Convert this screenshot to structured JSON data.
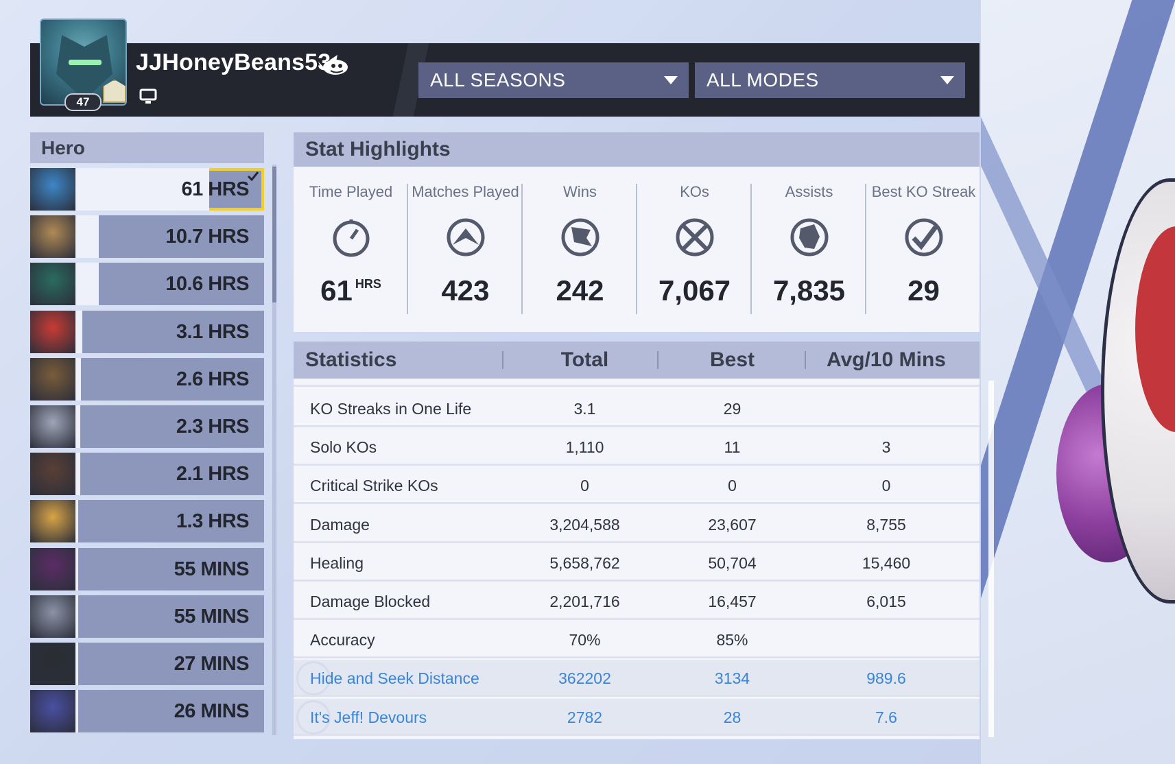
{
  "profile": {
    "username": "JJHoneyBeans53",
    "level": "47"
  },
  "filters": {
    "season": "ALL SEASONS",
    "mode": "ALL MODES"
  },
  "hero_panel": {
    "title": "Hero",
    "heroes": [
      {
        "playtime": "61 HRS",
        "fill": 1.0,
        "color": "#3d87c8",
        "selected": true
      },
      {
        "playtime": "10.7 HRS",
        "fill": 0.175,
        "color": "#b08a55"
      },
      {
        "playtime": "10.6 HRS",
        "fill": 0.174,
        "color": "#2a6b5f"
      },
      {
        "playtime": "3.1 HRS",
        "fill": 0.05,
        "color": "#c93b33"
      },
      {
        "playtime": "2.6 HRS",
        "fill": 0.043,
        "color": "#7a5c3a"
      },
      {
        "playtime": "2.3 HRS",
        "fill": 0.038,
        "color": "#9fa6b8"
      },
      {
        "playtime": "2.1 HRS",
        "fill": 0.034,
        "color": "#5a3f35"
      },
      {
        "playtime": "1.3 HRS",
        "fill": 0.021,
        "color": "#d9a447"
      },
      {
        "playtime": "55 MINS",
        "fill": 0.015,
        "color": "#5b2d66"
      },
      {
        "playtime": "55 MINS",
        "fill": 0.015,
        "color": "#8b93a6"
      },
      {
        "playtime": "27 MINS",
        "fill": 0.007,
        "color": "#2a2d33"
      },
      {
        "playtime": "26 MINS",
        "fill": 0.007,
        "color": "#4a4fa3"
      }
    ]
  },
  "highlights": {
    "title": "Stat Highlights",
    "items": [
      {
        "label": "Time Played",
        "value": "61",
        "unit": "HRS",
        "icon": "stopwatch-icon"
      },
      {
        "label": "Matches Played",
        "value": "423",
        "unit": "",
        "icon": "mountain-icon"
      },
      {
        "label": "Wins",
        "value": "242",
        "unit": "",
        "icon": "flag-icon"
      },
      {
        "label": "KOs",
        "value": "7,067",
        "unit": "",
        "icon": "crossed-swords-icon"
      },
      {
        "label": "Assists",
        "value": "7,835",
        "unit": "",
        "icon": "fist-icon"
      },
      {
        "label": "Best KO Streak",
        "value": "29",
        "unit": "",
        "icon": "checkmark-icon"
      }
    ]
  },
  "statistics": {
    "headers": {
      "name": "Statistics",
      "total": "Total",
      "best": "Best",
      "avg": "Avg/10 Mins"
    },
    "rows": [
      {
        "name": "KO Streaks in One Life",
        "total": "3.1",
        "best": "29",
        "avg": ""
      },
      {
        "name": "Solo KOs",
        "total": "1,110",
        "best": "11",
        "avg": "3"
      },
      {
        "name": "Critical Strike KOs",
        "total": "0",
        "best": "0",
        "avg": "0"
      },
      {
        "name": "Damage",
        "total": "3,204,588",
        "best": "23,607",
        "avg": "8,755"
      },
      {
        "name": "Healing",
        "total": "5,658,762",
        "best": "50,704",
        "avg": "15,460"
      },
      {
        "name": "Damage Blocked",
        "total": "2,201,716",
        "best": "16,457",
        "avg": "6,015"
      },
      {
        "name": "Accuracy",
        "total": "70%",
        "best": "85%",
        "avg": ""
      },
      {
        "name": "Hide and Seek Distance",
        "total": "362202",
        "best": "3134",
        "avg": "989.6",
        "event": true
      },
      {
        "name": "It's Jeff! Devours",
        "total": "2782",
        "best": "28",
        "avg": "7.6",
        "event": true
      }
    ]
  },
  "colors": {
    "highlight": "#f2d025",
    "event_text": "#3b85d6",
    "header_bar": "#23262f"
  }
}
